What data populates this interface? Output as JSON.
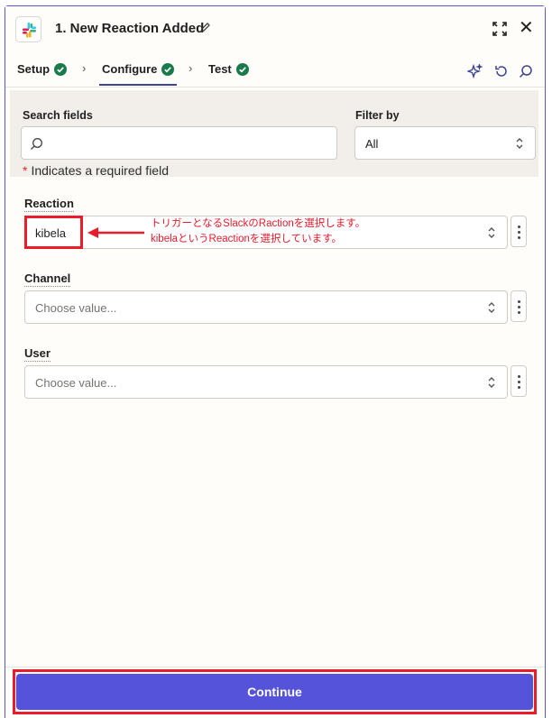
{
  "header": {
    "title": "1. New Reaction Added"
  },
  "tabs": [
    {
      "label": "Setup"
    },
    {
      "label": "Configure"
    },
    {
      "label": "Test"
    }
  ],
  "search": {
    "label": "Search fields",
    "placeholder": ""
  },
  "filter": {
    "label": "Filter by",
    "value": "All"
  },
  "required_note": {
    "star": "*",
    "text": "Indicates a required field"
  },
  "fields": {
    "reaction": {
      "label": "Reaction",
      "value": "kibela"
    },
    "channel": {
      "label": "Channel",
      "placeholder": "Choose value..."
    },
    "user": {
      "label": "User",
      "placeholder": "Choose value..."
    }
  },
  "annotation": {
    "line1": "トリガーとなるSlackのRactionを選択します。",
    "line2": "kibelaというReactionを選択しています。"
  },
  "footer": {
    "continue_label": "Continue"
  },
  "colors": {
    "accent": "#5553d9",
    "annotation_red": "#ea1b2b",
    "success_green": "#1b7a4c"
  }
}
